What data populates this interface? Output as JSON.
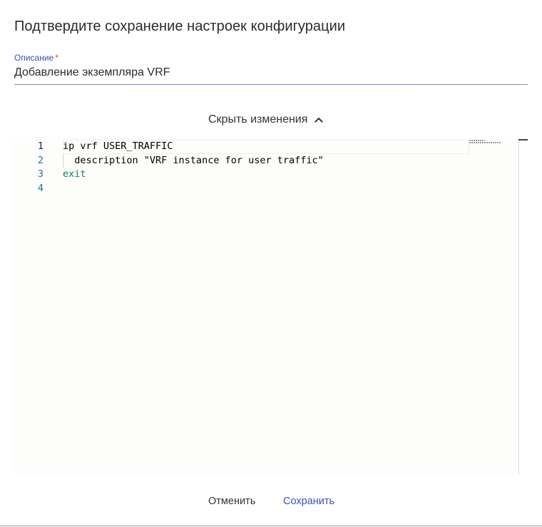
{
  "dialog": {
    "title": "Подтвердите сохранение настроек конфигурации"
  },
  "description_field": {
    "label": "Описание",
    "required_mark": "*",
    "value": "Добавление экземпляра VRF"
  },
  "diff_toggle": {
    "label": "Скрыть изменения",
    "icon": "chevron-up-icon"
  },
  "editor": {
    "line_numbers": [
      "1",
      "2",
      "3",
      "4"
    ],
    "lines": [
      "ip vrf USER_TRAFFIC",
      "  description \"VRF instance for user traffic\"",
      "exit",
      ""
    ]
  },
  "actions": {
    "cancel_label": "Отменить",
    "save_label": "Сохранить"
  },
  "colors": {
    "accent": "#3f51b5",
    "required": "#e53935",
    "line_number": "#237893",
    "keyword_exit": "#098658"
  }
}
